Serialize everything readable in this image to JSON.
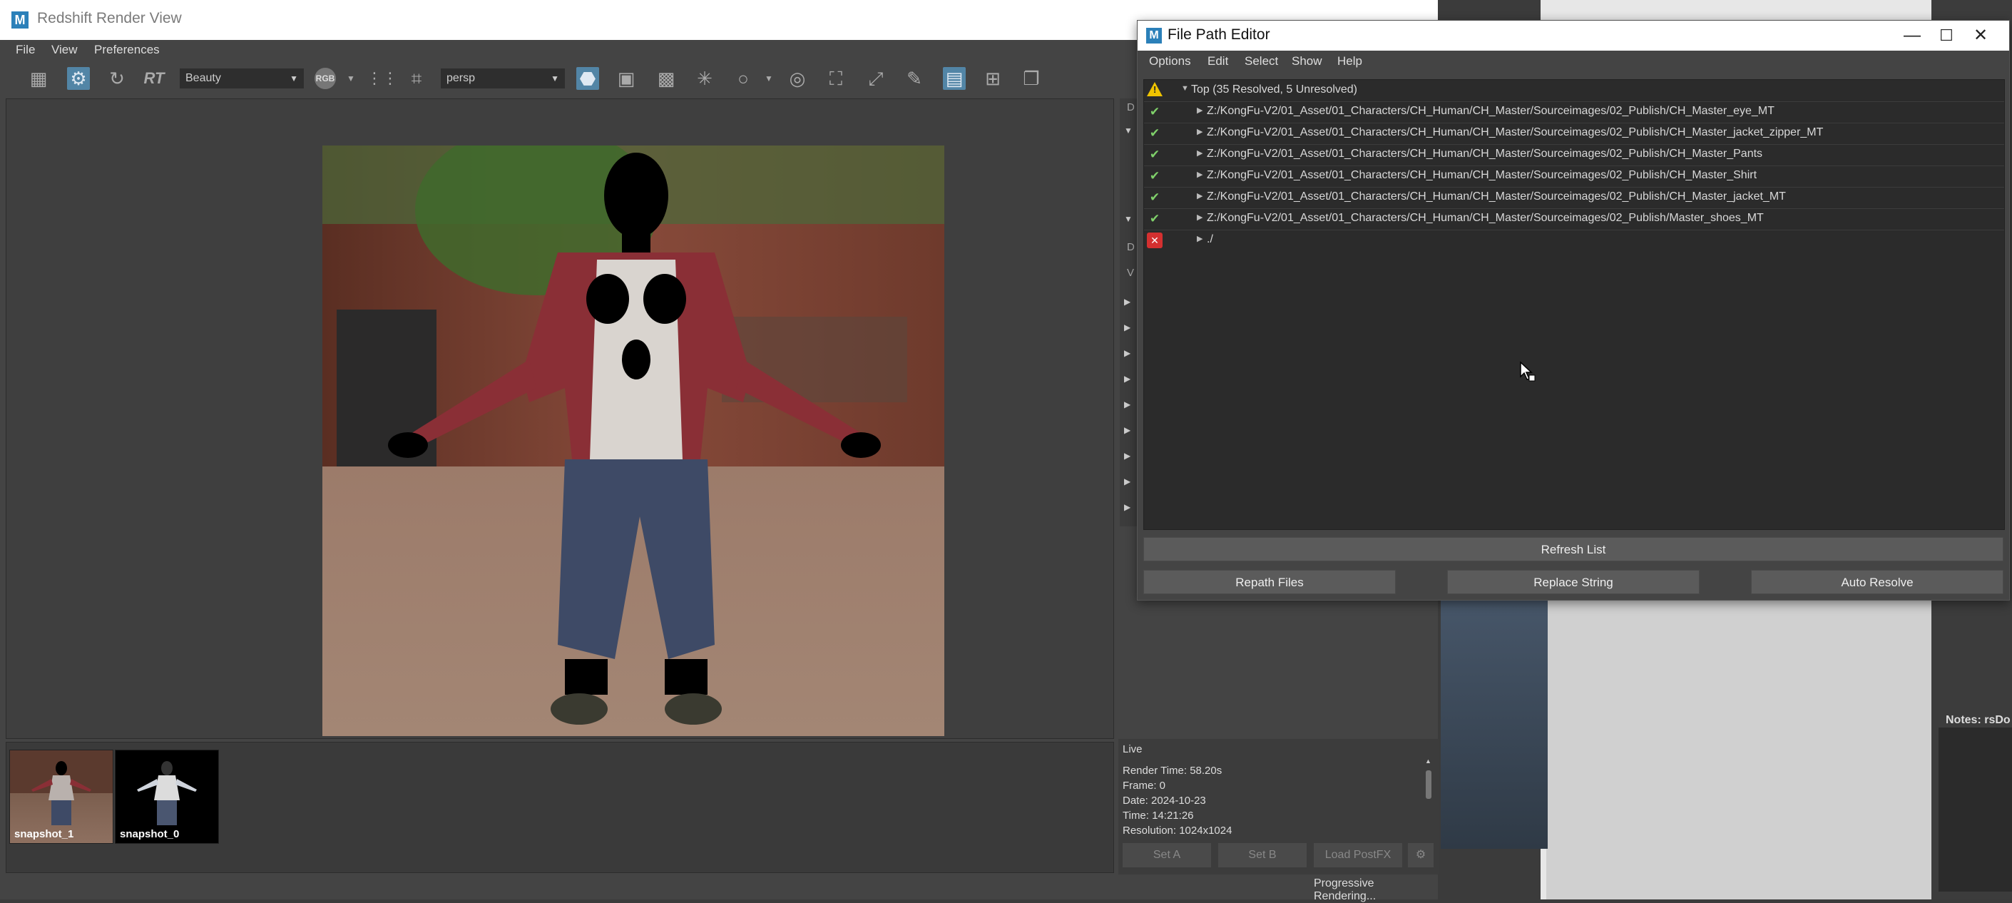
{
  "redshift": {
    "title": "Redshift Render View",
    "app_icon": "M",
    "menu": [
      "File",
      "View",
      "Preferences"
    ],
    "toolbar": {
      "rt_label": "RT",
      "aov": "Beauty",
      "rgb": "RGB",
      "camera": "persp",
      "icons": [
        "clapper-icon",
        "gear-icon",
        "refresh-icon",
        "rt-icon",
        "rgb-channel-icon",
        "dots-icon",
        "crop-icon",
        "camera-lock-icon",
        "video-camera-icon",
        "grid-icon",
        "snowflake-icon",
        "circle-icon",
        "target-icon",
        "focus-icon",
        "frame-icon",
        "edit-icon",
        "overlay-icon",
        "snapshot-add-icon",
        "copy-icon"
      ]
    },
    "side_letters": [
      "D",
      "D",
      "V"
    ],
    "snapshots": [
      {
        "label": "snapshot_1"
      },
      {
        "label": "snapshot_0"
      }
    ],
    "info": {
      "mode": "Live",
      "render_time": "Render Time: 58.20s",
      "frame": "Frame: 0",
      "date": "Date: 2024-10-23",
      "time": "Time: 14:21:26",
      "resolution": "Resolution: 1024x1024",
      "buttons": [
        "Set A",
        "Set B",
        "Load PostFX"
      ]
    },
    "status": "Progressive Rendering..."
  },
  "file_path_editor": {
    "title": "File Path Editor",
    "app_icon": "M",
    "menu": [
      "Options",
      "Edit",
      "Select",
      "Show",
      "Help"
    ],
    "window_controls": [
      "—",
      "☐",
      "✕"
    ],
    "tree_header": "Top (35 Resolved, 5 Unresolved)",
    "rows": [
      {
        "status": "resolved",
        "path": "Z:/KongFu-V2/01_Asset/01_Characters/CH_Human/CH_Master/Sourceimages/02_Publish/CH_Master_eye_MT"
      },
      {
        "status": "resolved",
        "path": "Z:/KongFu-V2/01_Asset/01_Characters/CH_Human/CH_Master/Sourceimages/02_Publish/CH_Master_jacket_zipper_MT"
      },
      {
        "status": "resolved",
        "path": "Z:/KongFu-V2/01_Asset/01_Characters/CH_Human/CH_Master/Sourceimages/02_Publish/CH_Master_Pants"
      },
      {
        "status": "resolved",
        "path": "Z:/KongFu-V2/01_Asset/01_Characters/CH_Human/CH_Master/Sourceimages/02_Publish/CH_Master_Shirt"
      },
      {
        "status": "resolved",
        "path": "Z:/KongFu-V2/01_Asset/01_Characters/CH_Human/CH_Master/Sourceimages/02_Publish/CH_Master_jacket_MT"
      },
      {
        "status": "resolved",
        "path": "Z:/KongFu-V2/01_Asset/01_Characters/CH_Human/CH_Master/Sourceimages/02_Publish/Master_shoes_MT"
      },
      {
        "status": "unresolved",
        "path": "./"
      }
    ],
    "buttons": {
      "refresh": "Refresh List",
      "repath": "Repath Files",
      "replace": "Replace String",
      "auto": "Auto Resolve"
    }
  },
  "background": {
    "notes_label": "Notes:  rsDo"
  },
  "colors": {
    "accent": "#5285a6",
    "resolved": "#7fd06a",
    "unresolved": "#d43030",
    "warning": "#f0c400"
  }
}
